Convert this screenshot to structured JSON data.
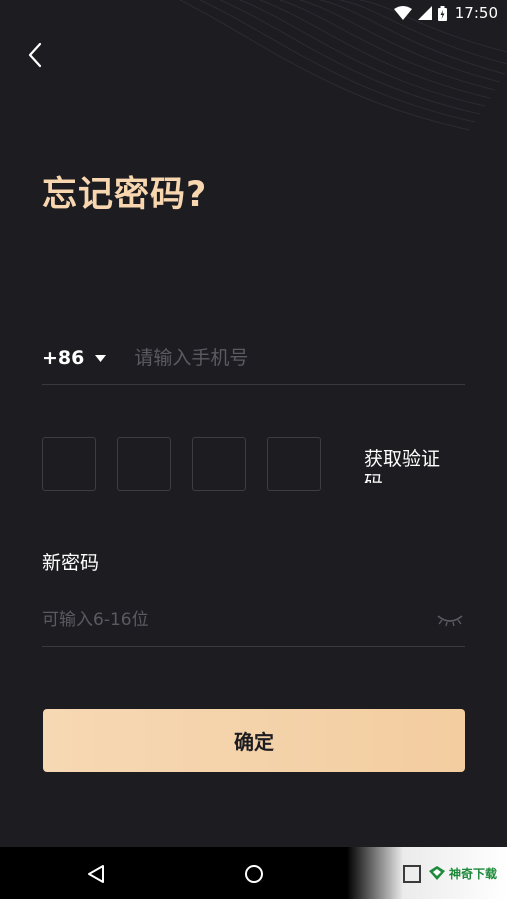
{
  "status_bar": {
    "time": "17:50",
    "icons": [
      "wifi-icon",
      "signal-icon",
      "battery-icon"
    ]
  },
  "header": {
    "back_icon": "chevron-left-icon",
    "title": "忘记密码?"
  },
  "phone": {
    "country_code": "+86",
    "placeholder": "请输入手机号",
    "value": ""
  },
  "verification": {
    "boxes": 4,
    "get_code_label": "获取验证码"
  },
  "new_password": {
    "label": "新密码",
    "placeholder": "可输入6-16位",
    "value": "",
    "toggle_icon": "eye-closed-icon"
  },
  "confirm_label": "确定",
  "nav": {
    "icons": [
      "back-triangle-icon",
      "home-circle-icon",
      "recents-square-icon"
    ]
  },
  "watermark": {
    "text": "神奇下载"
  },
  "colors": {
    "background": "#1d1c21",
    "title": "#f7d6b0",
    "button": "#f4d1a6",
    "divider": "#3a3940",
    "placeholder": "#5b5a61"
  }
}
